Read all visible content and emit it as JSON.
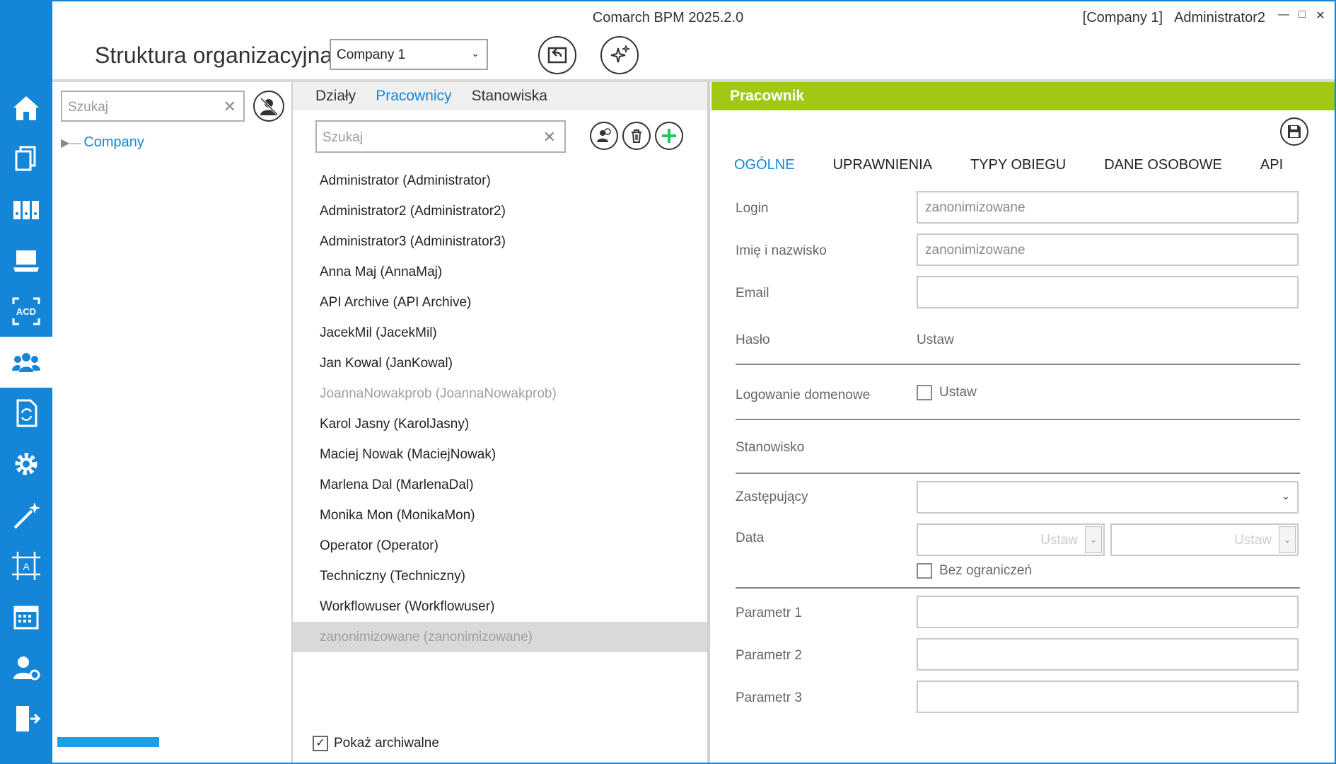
{
  "app": {
    "title": "Comarch BPM 2025.2.0",
    "company_tag": "[Company 1]",
    "user": "Administrator2",
    "window_controls": [
      "minimize-icon",
      "maximize-icon",
      "close-icon"
    ]
  },
  "rail": {
    "items": [
      {
        "icon": "home-icon"
      },
      {
        "icon": "documents-icon"
      },
      {
        "icon": "archive-binders-icon"
      },
      {
        "icon": "laptop-icon"
      },
      {
        "icon": "acd-icon"
      },
      {
        "icon": "users-icon",
        "active": true
      },
      {
        "icon": "document-sync-icon"
      },
      {
        "icon": "gear-icon"
      },
      {
        "icon": "magic-wand-icon"
      },
      {
        "icon": "template-designer-icon"
      },
      {
        "icon": "calendar-icon"
      },
      {
        "icon": "user-settings-icon"
      },
      {
        "icon": "logout-icon"
      }
    ],
    "accent": "#1585d8"
  },
  "header": {
    "page_title": "Struktura organizacyjna",
    "company_select": "Company 1"
  },
  "tree": {
    "search_placeholder": "Szukaj",
    "root": "Company"
  },
  "list": {
    "tabs": [
      "Działy",
      "Pracownicy",
      "Stanowiska"
    ],
    "active_tab": "Pracownicy",
    "search_placeholder": "Szukaj",
    "employees": [
      "Administrator (Administrator)",
      "Administrator2 (Administrator2)",
      "Administrator3 (Administrator3)",
      "Anna Maj (AnnaMaj)",
      "API Archive (API Archive)",
      "JacekMil (JacekMil)",
      "Jan Kowal (JanKowal)",
      "JoannaNowakprob (JoannaNowakprob)",
      "Karol Jasny (KarolJasny)",
      "Maciej Nowak (MaciejNowak)",
      "Marlena Dal (MarlenaDal)",
      "Monika Mon (MonikaMon)",
      "Operator (Operator)",
      "Techniczny (Techniczny)",
      "Workflowuser (Workflowuser)",
      "zanonimizowane (zanonimizowane)"
    ],
    "show_archived_label": "Pokaż archiwalne",
    "show_archived_checked": true
  },
  "detail": {
    "header": "Pracownik",
    "header_color": "#a0c814",
    "tabs": [
      "OGÓLNE",
      "UPRAWNIENIA",
      "TYPY OBIEGU",
      "DANE OSOBOWE",
      "API"
    ],
    "active_tab": "OGÓLNE",
    "login_label": "Login",
    "login_value": "zanonimizowane",
    "name_label": "Imię i nazwisko",
    "name_value": "zanonimizowane",
    "email_label": "Email",
    "email_value": "",
    "password_label": "Hasło",
    "password_value": "Ustaw",
    "domain_login_label": "Logowanie domenowe",
    "domain_login_option": "Ustaw",
    "position_label": "Stanowisko",
    "substitute_label": "Zastępujący",
    "date_label": "Data",
    "date_from": "Ustaw",
    "date_to": "Ustaw",
    "no_limit_label": "Bez ograniczeń",
    "param1_label": "Parametr 1",
    "param2_label": "Parametr 2",
    "param3_label": "Parametr 3"
  }
}
